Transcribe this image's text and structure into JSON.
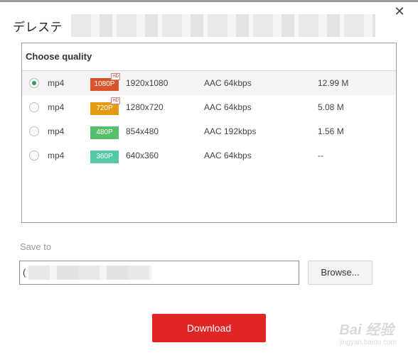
{
  "dialog": {
    "title": "デレステ",
    "close_glyph": "✕"
  },
  "quality": {
    "header": "Choose quality",
    "rows": [
      {
        "format": "mp4",
        "badge": "1080P",
        "badge_color": "#d9542a",
        "hd": "HD",
        "resolution": "1920x1080",
        "audio": "AAC 64kbps",
        "size": "12.99 M",
        "selected": true
      },
      {
        "format": "mp4",
        "badge": "720P",
        "badge_color": "#e59a12",
        "hd": "HD",
        "resolution": "1280x720",
        "audio": "AAC 64kbps",
        "size": "5.08 M",
        "selected": false
      },
      {
        "format": "mp4",
        "badge": "480P",
        "badge_color": "#56bf6b",
        "hd": "",
        "resolution": "854x480",
        "audio": "AAC 192kbps",
        "size": "1.56 M",
        "selected": false
      },
      {
        "format": "mp4",
        "badge": "360P",
        "badge_color": "#55c8a8",
        "hd": "",
        "resolution": "640x360",
        "audio": "AAC 64kbps",
        "size": "--",
        "selected": false
      }
    ]
  },
  "save": {
    "label": "Save to",
    "path_visible": "("
  },
  "buttons": {
    "browse": "Browse...",
    "download": "Download"
  },
  "watermark": {
    "brand": "Bai 经验",
    "url": "jingyan.baidu.com"
  },
  "colors": {
    "download_bg": "#e02525",
    "selected_radio": "#2e9e55"
  }
}
